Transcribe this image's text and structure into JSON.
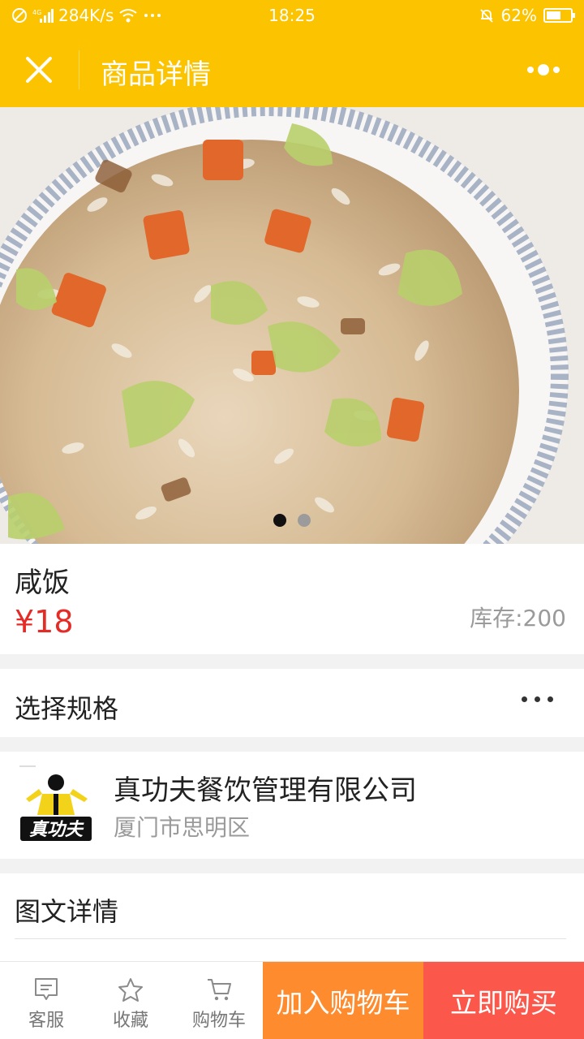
{
  "status_bar": {
    "network_speed": "284K/s",
    "time": "18:25",
    "battery": "62%",
    "battery_level": 0.62
  },
  "nav": {
    "title": "商品详情",
    "close_icon": "close-icon",
    "more_icon": "more-dots-icon"
  },
  "gallery": {
    "image_count": 2,
    "active_index": 0
  },
  "product": {
    "name": "咸饭",
    "price": "¥18",
    "stock": "库存:200"
  },
  "spec": {
    "label": "选择规格"
  },
  "shop": {
    "name": "真功夫餐饮管理有限公司",
    "address": "厦门市思明区",
    "logo_text": "真功夫"
  },
  "detail": {
    "title": "图文详情"
  },
  "bottom_bar": {
    "service_label": "客服",
    "favorite_label": "收藏",
    "cart_label": "购物车",
    "add_to_cart_label": "加入购物车",
    "buy_now_label": "立即购买"
  },
  "colors": {
    "brand": "#fcc400",
    "price": "#e52b26",
    "add_to_cart": "#fe8c2e",
    "buy_now": "#fb574b"
  }
}
